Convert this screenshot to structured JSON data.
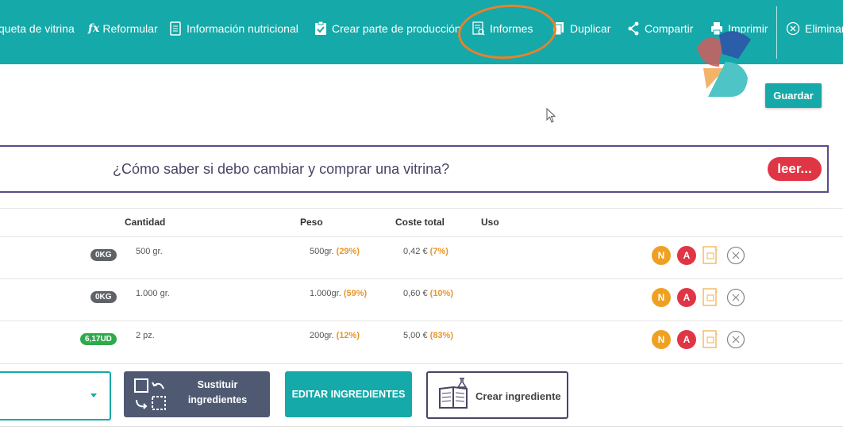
{
  "toolbar": {
    "items": [
      {
        "label": "queta de vitrina"
      },
      {
        "label": "Reformular",
        "icon": "fx-icon"
      },
      {
        "label": "Información nutricional",
        "icon": "nutrition-icon"
      },
      {
        "label": "Crear parte de producción",
        "icon": "clipboard-icon"
      },
      {
        "label": "Informes",
        "icon": "report-icon"
      },
      {
        "label": "Duplicar",
        "icon": "copy-icon"
      },
      {
        "label": "Compartir",
        "icon": "share-icon"
      },
      {
        "label": "Imprimir",
        "icon": "printer-icon"
      },
      {
        "label": "Eliminar",
        "icon": "close-circle-icon"
      }
    ],
    "fx_glyph": "fx",
    "accent": "#15a9a9",
    "highlight_color": "#e8812b"
  },
  "save_button": {
    "label": "Guardar"
  },
  "banner": {
    "text": "¿Cómo saber si debo cambiar y comprar una vitrina?",
    "cta": "leer..."
  },
  "table": {
    "headers": [
      "Cantidad",
      "Peso",
      "Coste total",
      "Uso"
    ],
    "rows": [
      {
        "stock": "0KG",
        "stock_color": "#5f6368",
        "cantidad": "500 gr.",
        "peso": "500gr.",
        "peso_pct": "(29%)",
        "coste": "0,42 €",
        "coste_pct": "(7%)",
        "btn_n": "N",
        "btn_a": "A"
      },
      {
        "stock": "0KG",
        "stock_color": "#5f6368",
        "cantidad": "1.000 gr.",
        "peso": "1.000gr.",
        "peso_pct": "(59%)",
        "coste": "0,60 €",
        "coste_pct": "(10%)",
        "btn_n": "N",
        "btn_a": "A"
      },
      {
        "stock": "6,17UD",
        "stock_color": "#2eaa4a",
        "cantidad": "2 pz.",
        "peso": "200gr.",
        "peso_pct": "(12%)",
        "coste": "5,00 €",
        "coste_pct": "(83%)",
        "btn_n": "N",
        "btn_a": "A"
      }
    ]
  },
  "actions": {
    "sustituir": "Sustituir ingredientes",
    "sustituir_line1": "Sustituir",
    "sustituir_line2": "ingredientes",
    "editar": "EDITAR INGREDIENTES",
    "crear": "Crear ingrediente"
  },
  "colors": {
    "n_badge": "#f0a020",
    "a_badge": "#e03545",
    "red": "#e03545",
    "slate": "#4f5a72"
  }
}
